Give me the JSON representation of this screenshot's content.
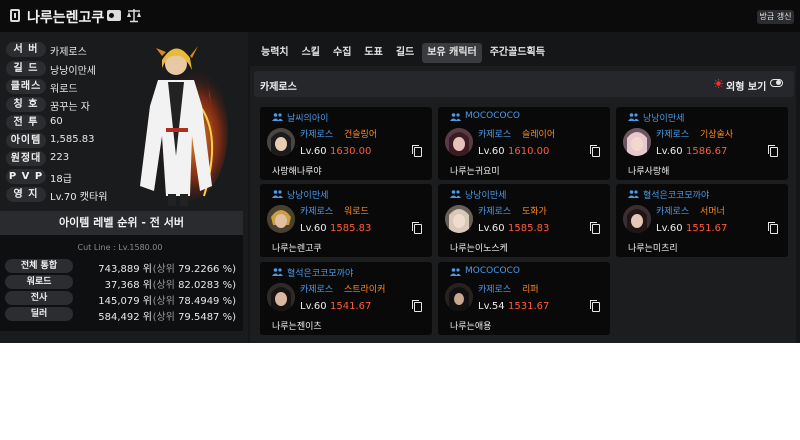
{
  "header": {
    "title": "나루는렌고쿠",
    "refresh_label": "방금 갱신"
  },
  "profile": {
    "rows": [
      {
        "label": "서 버",
        "value": "카제로스"
      },
      {
        "label": "길 드",
        "value": "낭낭이만세"
      },
      {
        "label": "클래스",
        "value": "워로드"
      },
      {
        "label": "칭 호",
        "value": "꿈꾸는 자"
      },
      {
        "label": "전 투",
        "value": "60"
      },
      {
        "label": "아이템",
        "value": "1,585.83"
      },
      {
        "label": "원정대",
        "value": "223"
      },
      {
        "label": "P V P",
        "value": "18급"
      },
      {
        "label": "영 지",
        "value": "Lv.70 캣타워"
      }
    ]
  },
  "ranking": {
    "title": "아이템 레벨 순위 - 전 서버",
    "cutline": "Cut Line : Lv.1580.00",
    "rows": [
      {
        "label": "전체 통합",
        "rank": "743,889 위",
        "pct_prefix": "(상위",
        "pct": "79.2266 %)"
      },
      {
        "label": "워로드",
        "rank": "37,368 위",
        "pct_prefix": "(상위",
        "pct": "82.0283 %)"
      },
      {
        "label": "전사",
        "rank": "145,079 위",
        "pct_prefix": "(상위",
        "pct": "78.4949 %)"
      },
      {
        "label": "딜러",
        "rank": "584,492 위",
        "pct_prefix": "(상위",
        "pct": "79.5487 %)"
      }
    ]
  },
  "tabs": [
    "능력치",
    "스킬",
    "수집",
    "도표",
    "길드",
    "보유 캐릭터",
    "주간골드획득"
  ],
  "active_tab": 5,
  "section": {
    "title": "카제로스",
    "appearance_label": "외형 보기"
  },
  "characters": [
    {
      "guild": "날씨의아이",
      "server": "카제로스",
      "class": "건슬링어",
      "level": "Lv.60",
      "item_level": "1630.00",
      "name": "사랑해나루야"
    },
    {
      "guild": "MOCOCOCO",
      "server": "카제로스",
      "class": "슬레이어",
      "level": "Lv.60",
      "item_level": "1610.00",
      "name": "나루는귀요미"
    },
    {
      "guild": "낭낭이만세",
      "server": "카제로스",
      "class": "기상술사",
      "level": "Lv.60",
      "item_level": "1586.67",
      "name": "나루사랑해"
    },
    {
      "guild": "낭낭이만세",
      "server": "카제로스",
      "class": "워로드",
      "level": "Lv.60",
      "item_level": "1585.83",
      "name": "나루는렌고쿠"
    },
    {
      "guild": "낭낭이만세",
      "server": "카제로스",
      "class": "도화가",
      "level": "Lv.60",
      "item_level": "1585.83",
      "name": "나루는이노스케"
    },
    {
      "guild": "혈석은코코모까야",
      "server": "카제로스",
      "class": "서머너",
      "level": "Lv.60",
      "item_level": "1551.67",
      "name": "나루는미츠리"
    },
    {
      "guild": "혈석은코코모까야",
      "server": "카제로스",
      "class": "스트라이커",
      "level": "Lv.60",
      "item_level": "1541.67",
      "name": "나루는젠이츠"
    },
    {
      "guild": "MOCOCOCO",
      "server": "카제로스",
      "class": "리퍼",
      "level": "Lv.54",
      "item_level": "1531.67",
      "name": "나루는애용"
    }
  ]
}
